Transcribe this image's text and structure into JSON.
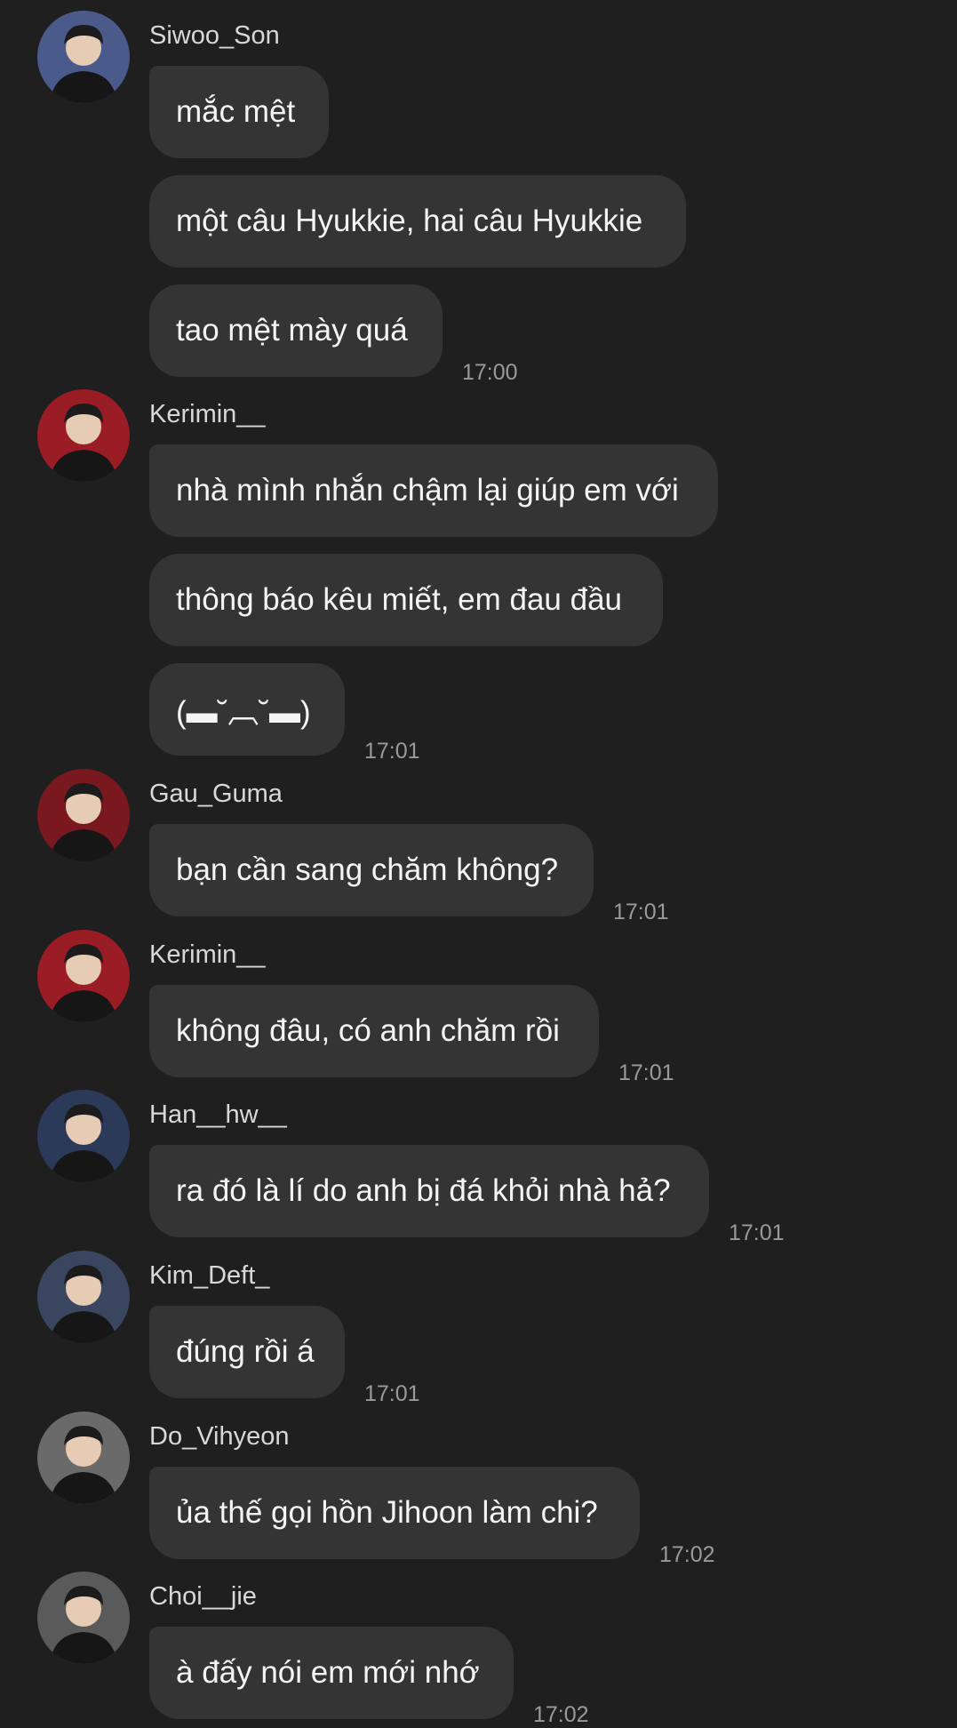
{
  "messages": [
    {
      "sender": "Siwoo_Son",
      "avatar": "avatar-siwoo-son",
      "avatar_bg": "#4a5a8a",
      "bubbles": [
        "mắc mệt",
        "một câu Hyukkie, hai câu Hyukkie",
        "tao mệt mày quá"
      ],
      "time": "17:00"
    },
    {
      "sender": "Kerimin__",
      "avatar": "avatar-kerimin",
      "avatar_bg": "#9a1c24",
      "bubbles": [
        "nhà mình nhắn chậm lại giúp em với",
        "thông báo kêu miết, em đau đầu",
        "(▬˘︹˘▬)"
      ],
      "time": "17:01"
    },
    {
      "sender": "Gau_Guma",
      "avatar": "avatar-gau-guma",
      "avatar_bg": "#7a1820",
      "bubbles": [
        "bạn cần sang chăm không?"
      ],
      "time": "17:01"
    },
    {
      "sender": "Kerimin__",
      "avatar": "avatar-kerimin",
      "avatar_bg": "#9a1c24",
      "bubbles": [
        "không đâu, có anh chăm rồi"
      ],
      "time": "17:01"
    },
    {
      "sender": "Han__hw__",
      "avatar": "avatar-han-hw",
      "avatar_bg": "#2c3a5a",
      "bubbles": [
        "ra đó là lí do anh bị đá khỏi nhà hả?"
      ],
      "time": "17:01"
    },
    {
      "sender": "Kim_Deft_",
      "avatar": "avatar-kim-deft",
      "avatar_bg": "#3a4660",
      "bubbles": [
        "đúng rồi á"
      ],
      "time": "17:01"
    },
    {
      "sender": "Do_Vihyeon",
      "avatar": "avatar-do-vihyeon",
      "avatar_bg": "#6a6a6a",
      "bubbles": [
        "ủa thế gọi hồn Jihoon làm chi?"
      ],
      "time": "17:02"
    },
    {
      "sender": "Choi__jie",
      "avatar": "avatar-choi-jie",
      "avatar_bg": "#5a5a5a",
      "bubbles": [
        "à đấy nói em mới nhớ"
      ],
      "time": "17:02"
    }
  ]
}
